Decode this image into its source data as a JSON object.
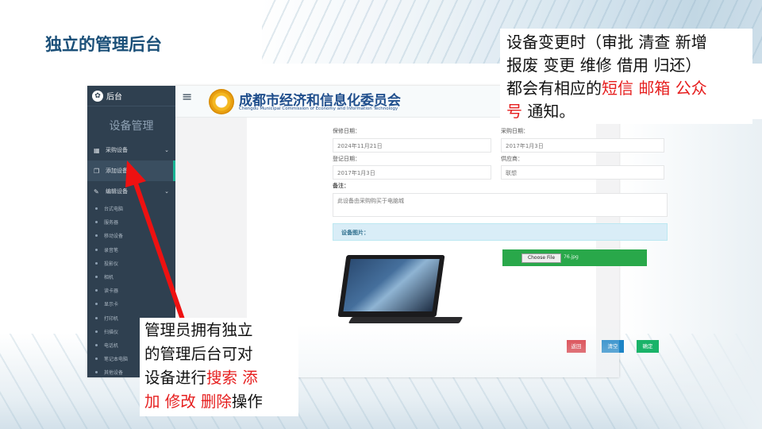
{
  "slide": {
    "title": "独立的管理后台"
  },
  "callout_top": {
    "line1": "设备变更时（审批 清查 新增",
    "line2": "报废 变更 维修 借用 归还）",
    "line3_black": "都会有相应的",
    "line3_red": "短信 邮箱 公众",
    "line4_red": "号",
    "line4_black": " 通知。"
  },
  "callout_bottom": {
    "line1": "管理员拥有独立",
    "line2": "的管理后台可对",
    "line3_black": "设备进行",
    "line3_red": "搜索 添",
    "line4_red": "加 修改 删除",
    "line4_black": "操作"
  },
  "sidebar": {
    "header_label": "后台",
    "section_title": "设备管理",
    "groups": [
      {
        "label": "采购设备"
      },
      {
        "label": "添加设备"
      },
      {
        "label": "编辑设备"
      }
    ],
    "sub_items": [
      "台式电脑",
      "服务器",
      "移动设备",
      "录音笔",
      "投影仪",
      "相机",
      "读卡器",
      "显示卡",
      "打印机",
      "扫描仪",
      "电话机",
      "笔记本电脑",
      "其他设备"
    ]
  },
  "header": {
    "org_name": "成都市经济和信息化委员会",
    "org_name_en": "Chengdu Municipal Commission of Economy and Information Technology"
  },
  "form": {
    "warranty_label": "保修日期：",
    "warranty_value": "2024年11月21日",
    "purchase_label": "采购日期：",
    "purchase_value": "2017年1月3日",
    "register_label": "登记日期：",
    "register_value": "2017年1月3日",
    "supplier_label": "供应商：",
    "supplier_value": "联想",
    "remark_label": "备注：",
    "remark_value": "此设备由采购购买于电脑城",
    "image_panel_label": "设备图片：",
    "file_button": "Choose File",
    "file_name": "76.jpg",
    "buttons": {
      "back": "返回",
      "clear": "清空",
      "confirm": "确定"
    }
  },
  "colors": {
    "title_blue": "#1a4f78",
    "highlight_red": "#e61e1e",
    "sidebar_bg": "#2f4050",
    "btn_back": "#d9363e",
    "btn_clear": "#1c84c6",
    "btn_confirm": "#1ab369"
  }
}
